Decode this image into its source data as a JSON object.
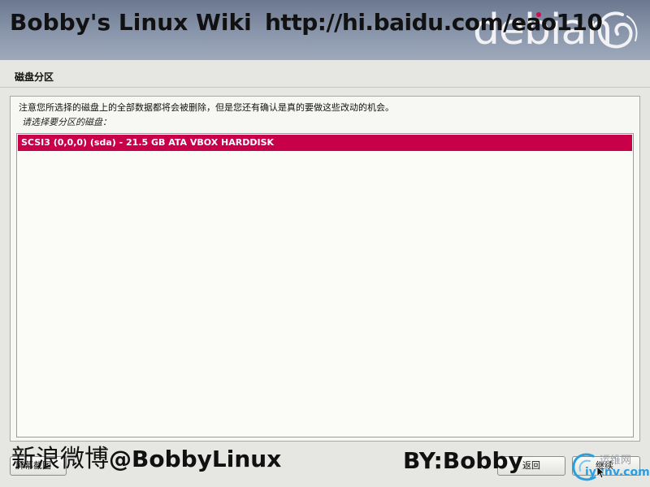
{
  "header": {
    "overlay_title": "Bobby's Linux Wiki",
    "overlay_url": "http://hi.baidu.com/eao110",
    "logo_word": "debian",
    "logo_color": "#d40b4e"
  },
  "step": {
    "title": "磁盘分区"
  },
  "panel": {
    "notice": "注意您所选择的磁盘上的全部数据都将会被删除，但是您还有确认是真的要做这些改动的机会。",
    "prompt": "请选择要分区的磁盘：",
    "disks": [
      {
        "label": "SCSI3 (0,0,0) (sda) - 21.5 GB ATA VBOX HARDDISK",
        "selected": true
      }
    ],
    "selection_color": "#c8004a"
  },
  "buttons": {
    "screenshot": "屏幕截图",
    "back": "返回",
    "continue": "继续"
  },
  "watermarks": {
    "weibo_cn": "新浪微博",
    "weibo_handle": "@BobbyLinux",
    "byline": "BY:Bobby",
    "site_cn": "运维网",
    "site_url": "iyunv.com"
  }
}
